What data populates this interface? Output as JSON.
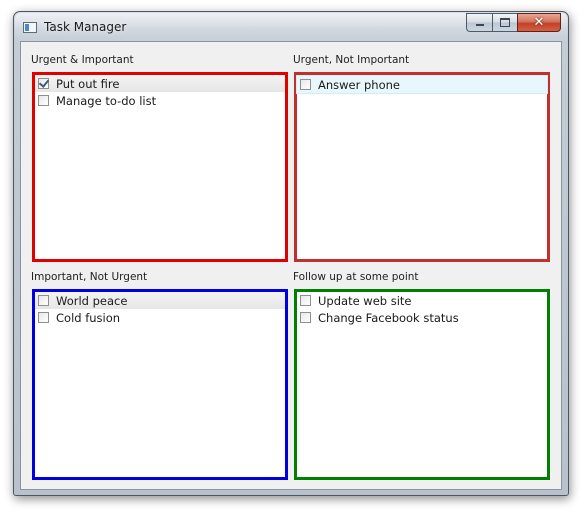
{
  "window": {
    "title": "Task Manager",
    "icons": {
      "app": "app-window-icon",
      "minimize": "minimize-icon",
      "maximize": "maximize-icon",
      "close": "close-icon"
    }
  },
  "quadrants": [
    {
      "label": "Urgent & Important",
      "border_color": "#e00000",
      "items": [
        {
          "text": "Put out fire",
          "checked": true,
          "highlight": "gray"
        },
        {
          "text": "Manage to-do list",
          "checked": false,
          "highlight": ""
        }
      ]
    },
    {
      "label": "Urgent, Not Important",
      "border_color": "#c0302c",
      "items": [
        {
          "text": "Answer phone",
          "checked": false,
          "highlight": "blue"
        }
      ]
    },
    {
      "label": "Important, Not Urgent",
      "border_color": "#0000e0",
      "items": [
        {
          "text": "World peace",
          "checked": false,
          "highlight": "gray"
        },
        {
          "text": "Cold fusion",
          "checked": false,
          "highlight": ""
        }
      ]
    },
    {
      "label": "Follow up at some point",
      "border_color": "#008000",
      "items": [
        {
          "text": "Update web site",
          "checked": false,
          "highlight": ""
        },
        {
          "text": "Change Facebook status",
          "checked": false,
          "highlight": ""
        }
      ]
    }
  ]
}
